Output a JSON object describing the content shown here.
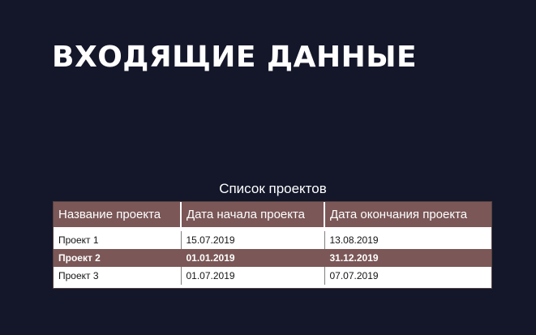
{
  "slide": {
    "title": "ВХОДЯЩИЕ ДАННЫЕ",
    "caption": "Список проектов"
  },
  "table": {
    "headers": [
      "Название проекта",
      "Дата начала проекта",
      "Дата окончания проекта"
    ],
    "rows": [
      [
        "Проект 1",
        "15.07.2019",
        "13.08.2019"
      ],
      [
        "Проект 2",
        "01.01.2019",
        "31.12.2019"
      ],
      [
        "Проект 3",
        "01.07.2019",
        "07.07.2019"
      ]
    ]
  },
  "colors": {
    "background": "#14172a",
    "header_fill": "#7b5757",
    "alt_row_fill": "#7b5757",
    "text_light": "#ffffff",
    "text_dark": "#141414"
  }
}
